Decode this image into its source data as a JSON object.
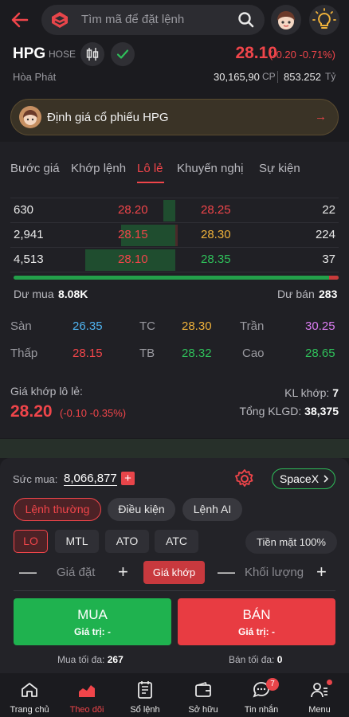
{
  "search": {
    "placeholder": "Tìm mã để đặt lệnh"
  },
  "stock": {
    "symbol": "HPG",
    "exchange": "HOSE",
    "price": "28.10",
    "change": "(-0.20 -0.71%)",
    "company": "Hòa Phát",
    "volume": "30,165,90",
    "volume_unit": "CP",
    "value": "853.252",
    "value_unit": "Tỷ"
  },
  "banner": {
    "text": "Định giá cổ phiếu HPG",
    "arrow": "→"
  },
  "tabs": [
    {
      "label": "Bước giá"
    },
    {
      "label": "Khớp lệnh"
    },
    {
      "label": "Lô lẻ"
    },
    {
      "label": "Khuyến nghị"
    },
    {
      "label": "Sự kiện"
    }
  ],
  "orderbook": {
    "rows": [
      {
        "bid_vol": "630",
        "bid_price": "28.20",
        "ask_price": "28.25",
        "ask_vol": "22",
        "bid_ratio": 0.13,
        "ask_ratio": 0.0
      },
      {
        "bid_vol": "2,941",
        "bid_price": "28.15",
        "ask_price": "28.30",
        "ask_vol": "224",
        "bid_ratio": 0.6,
        "ask_ratio": 0.03
      },
      {
        "bid_vol": "4,513",
        "bid_price": "28.10",
        "ask_price": "28.35",
        "ask_vol": "37",
        "bid_ratio": 1.0,
        "ask_ratio": 0.0
      }
    ],
    "buy_ratio": 0.97,
    "du_mua_label": "Dư mua",
    "du_mua": "8.08K",
    "du_ban_label": "Dư bán",
    "du_ban": "283"
  },
  "stats": {
    "san_label": "Sàn",
    "san": "26.35",
    "tc_label": "TC",
    "tc": "28.30",
    "tran_label": "Trần",
    "tran": "30.25",
    "thap_label": "Thấp",
    "thap": "28.15",
    "tb_label": "TB",
    "tb": "28.32",
    "cao_label": "Cao",
    "cao": "28.65"
  },
  "last_trade": {
    "label": "Giá khớp lô lẻ:",
    "price": "28.20",
    "change": "(-0.10 -0.35%)",
    "kl_label": "KL khớp:",
    "kl": "7",
    "tong_label": "Tổng KLGD:",
    "tong": "38,375"
  },
  "order": {
    "suc_mua_label": "Sức mua:",
    "suc_mua": "8,066,877",
    "account": "SpaceX",
    "modes": [
      "Lệnh thường",
      "Điều kiện",
      "Lệnh AI"
    ],
    "types": [
      "LO",
      "MTL",
      "ATO",
      "ATC"
    ],
    "cash": "Tiền mặt 100%",
    "price_placeholder": "Giá đặt",
    "match_label": "Giá khớp",
    "qty_placeholder": "Khối lượng",
    "buy_label": "MUA",
    "buy_sub": "Giá trị: -",
    "sell_label": "BÁN",
    "sell_sub": "Giá trị: -",
    "max_buy_label": "Mua tối đa:",
    "max_buy": "267",
    "max_sell_label": "Bán tối đa:",
    "max_sell": "0"
  },
  "nav": [
    {
      "label": "Trang chủ"
    },
    {
      "label": "Theo dõi"
    },
    {
      "label": "Sổ lệnh"
    },
    {
      "label": "Sở hữu"
    },
    {
      "label": "Tin nhắn",
      "badge": "7"
    },
    {
      "label": "Menu"
    }
  ],
  "colors": {
    "up": "#2fbf5a",
    "down": "#f0454a",
    "ref": "#f0b23a",
    "ceiling": "#d97cf0",
    "floor": "#4fb3f0"
  }
}
